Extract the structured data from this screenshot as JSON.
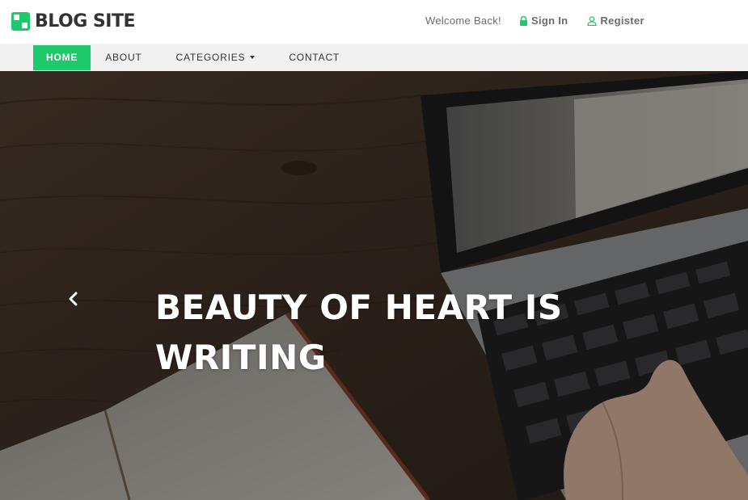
{
  "header": {
    "logo_text": "BLOG SITE",
    "welcome_text": "Welcome Back!",
    "sign_in_label": "Sign In",
    "register_label": "Register"
  },
  "nav": {
    "items": [
      {
        "label": "HOME",
        "active": true
      },
      {
        "label": "ABOUT"
      },
      {
        "label": "CATEGORIES",
        "dropdown": true
      },
      {
        "label": "CONTACT"
      }
    ]
  },
  "hero": {
    "title": "BEAUTY OF HEART IS WRITING"
  },
  "colors": {
    "accent": "#1ec96b",
    "nav_bg": "#f1f1f1",
    "text_dark": "#333333"
  },
  "icons": {
    "logo": "logo-icon",
    "sign_in": "lock-icon",
    "register": "user-icon",
    "prev": "chevron-left-icon"
  }
}
